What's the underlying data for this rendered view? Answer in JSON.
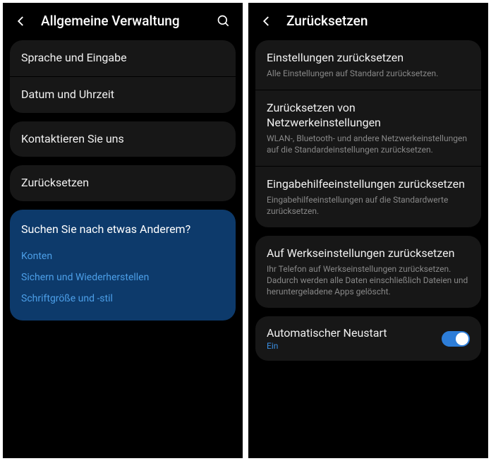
{
  "left": {
    "title": "Allgemeine Verwaltung",
    "group1": [
      {
        "title": "Sprache und Eingabe"
      },
      {
        "title": "Datum und Uhrzeit"
      }
    ],
    "group2": [
      {
        "title": "Kontaktieren Sie uns"
      }
    ],
    "group3": [
      {
        "title": "Zurücksetzen"
      }
    ],
    "suggest": {
      "heading": "Suchen Sie nach etwas Anderem?",
      "links": [
        "Konten",
        "Sichern und Wiederherstellen",
        "Schriftgröße und -stil"
      ]
    }
  },
  "right": {
    "title": "Zurücksetzen",
    "group1": [
      {
        "title": "Einstellungen zurücksetzen",
        "sub": "Alle Einstellungen auf Standard zurücksetzen."
      },
      {
        "title": "Zurücksetzen von Netzwerkeinstellungen",
        "sub": "WLAN-, Bluetooth- und andere Netzwerkeinstellungen auf die Standardeinstellungen zurücksetzen."
      },
      {
        "title": "Eingabehilfeeinstellungen zurücksetzen",
        "sub": "Eingabehilfeeinstellungen auf die Standardwerte zurücksetzen."
      }
    ],
    "group2": [
      {
        "title": "Auf Werkseinstellungen zurücksetzen",
        "sub": "Ihr Telefon auf Werkseinstellungen zurücksetzen. Dadurch werden alle Daten einschließlich Dateien und heruntergeladene Apps gelöscht."
      }
    ],
    "toggle": {
      "title": "Automatischer Neustart",
      "sub": "Ein",
      "on": true
    }
  }
}
